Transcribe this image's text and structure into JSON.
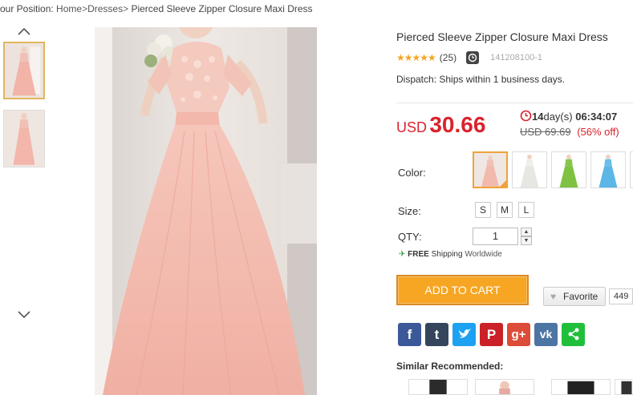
{
  "breadcrumb": {
    "prefix": "our Position:",
    "home": "Home",
    "sep1": ">",
    "category": "Dresses",
    "sep2": ">",
    "current": "Pierced Sleeve Zipper Closure Maxi Dress"
  },
  "gallery": {
    "up_icon": "chevron-up-icon",
    "down_icon": "chevron-down-icon",
    "thumbnails": [
      {
        "active": true,
        "color": "#f2b9ad"
      },
      {
        "active": false,
        "color": "#f2b9ad"
      }
    ]
  },
  "product": {
    "title": "Pierced Sleeve Zipper Closure Maxi Dress",
    "stars": "★★★★★",
    "rating_value": 5,
    "review_count": "(25)",
    "sku": "141208100-1",
    "dispatch": "Dispatch: Ships within 1 business days.",
    "currency": "USD",
    "price": "30.66",
    "countdown_days": "14",
    "countdown_days_label": "day(s)",
    "countdown_time": "06:34:07",
    "old_price": "USD 69.69",
    "discount": "(56% off)"
  },
  "options": {
    "color_label": "Color:",
    "colors": [
      {
        "name": "pink",
        "hex": "#f2b9ad",
        "active": true
      },
      {
        "name": "white",
        "hex": "#f4f4f2",
        "active": false
      },
      {
        "name": "green",
        "hex": "#7fc241",
        "active": false
      },
      {
        "name": "blue",
        "hex": "#5cb6e6",
        "active": false
      }
    ],
    "size_label": "Size:",
    "sizes": [
      "S",
      "M",
      "L"
    ],
    "qty_label": "QTY:",
    "qty_value": "1"
  },
  "shipping": {
    "free_bold": "FREE",
    "free_text": "Shipping",
    "free_scope": "Worldwide"
  },
  "actions": {
    "add_to_cart": "ADD TO CART",
    "favorite": "Favorite",
    "favorite_count": "449"
  },
  "social": [
    {
      "name": "facebook",
      "glyph": "f",
      "color": "#3b5998"
    },
    {
      "name": "tumblr",
      "glyph": "t",
      "color": "#35465c"
    },
    {
      "name": "twitter",
      "glyph": "t",
      "color": "#1da1f2"
    },
    {
      "name": "pinterest",
      "glyph": "P",
      "color": "#cb2027"
    },
    {
      "name": "google-plus",
      "glyph": "g+",
      "color": "#dd4b39"
    },
    {
      "name": "vk",
      "glyph": "vk",
      "color": "#4c75a3"
    },
    {
      "name": "share",
      "glyph": "<",
      "color": "#1fbf3b"
    }
  ],
  "similar": {
    "label": "Similar Recommended:"
  }
}
